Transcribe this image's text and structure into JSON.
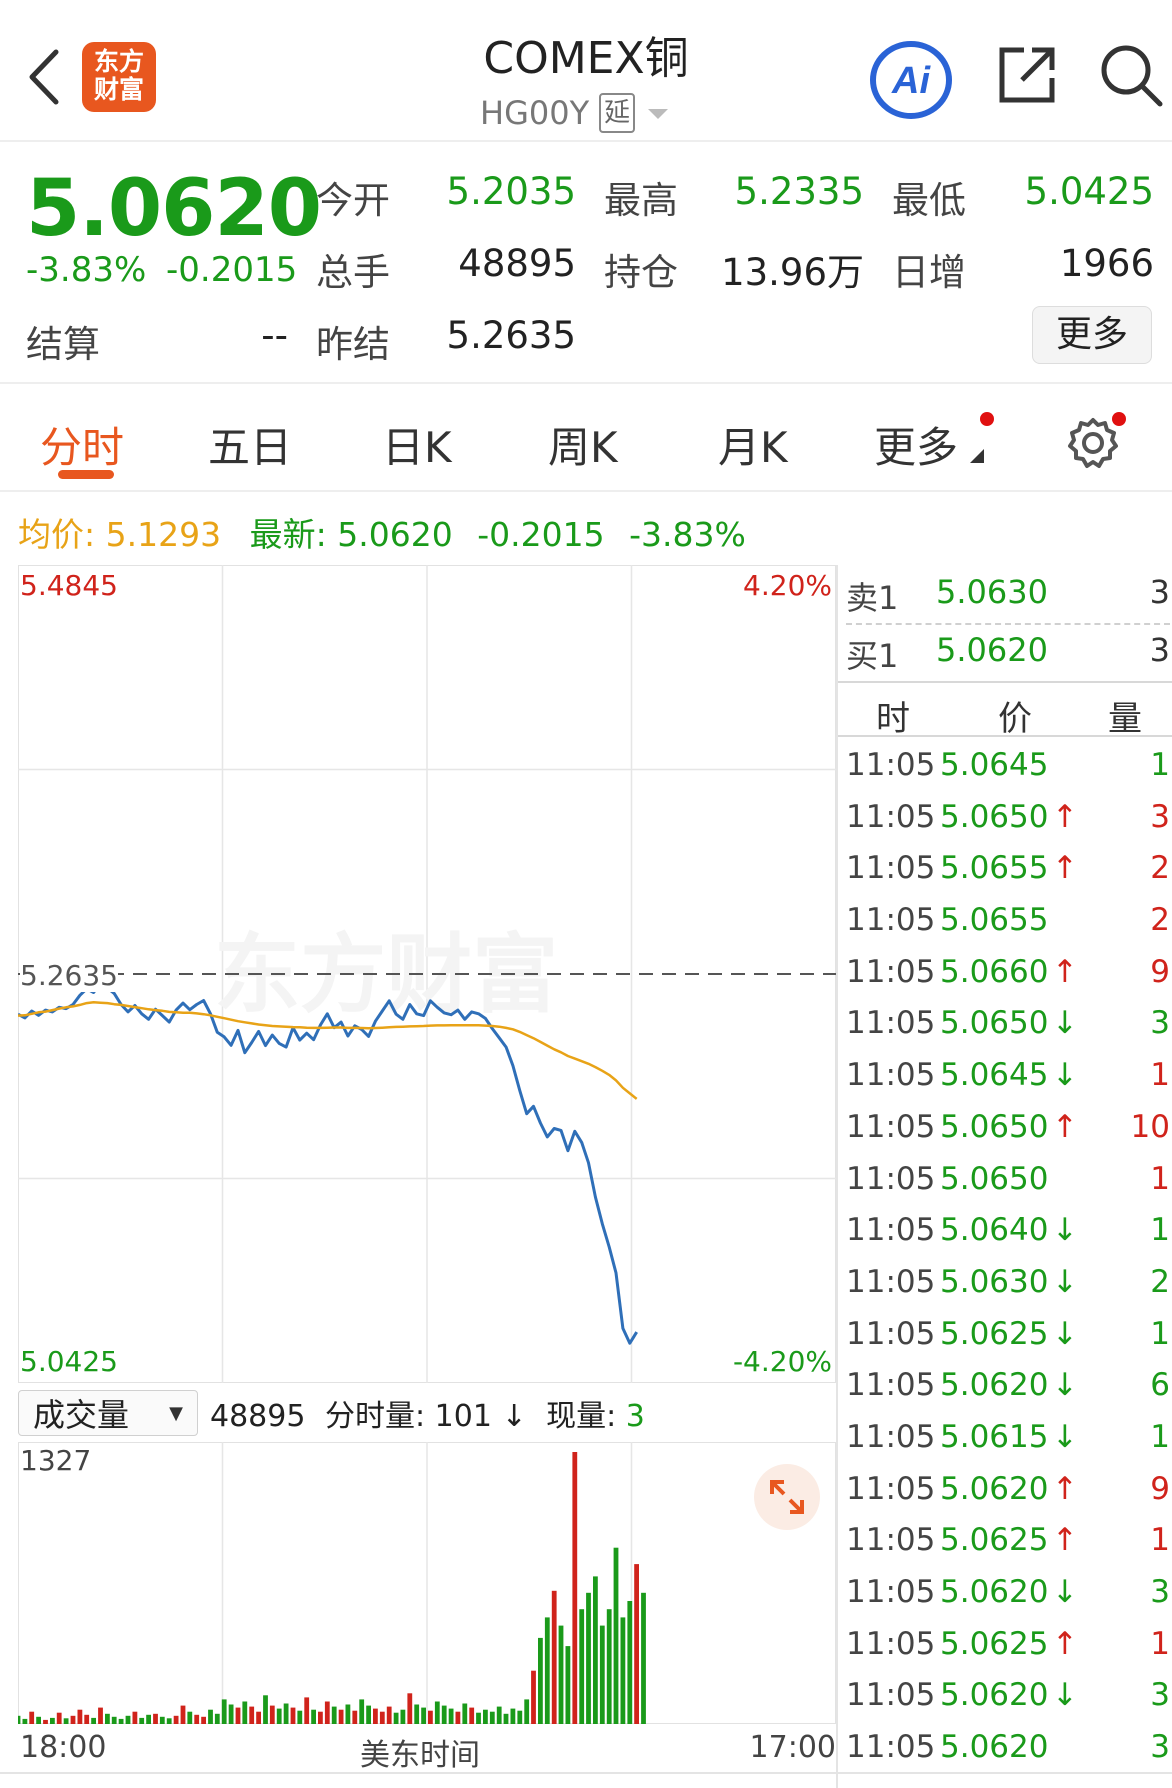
{
  "header": {
    "logo_text": "东方财富",
    "title": "COMEX铜",
    "symbol": "HG00Y",
    "delay_badge": "延",
    "ai_label": "Ai"
  },
  "quote": {
    "last_price": "5.0620",
    "change_pct": "-3.83%",
    "change_abs": "-0.2015",
    "fields": {
      "open_label": "今开",
      "open": "5.2035",
      "high_label": "最高",
      "high": "5.2335",
      "low_label": "最低",
      "low": "5.0425",
      "volume_label": "总手",
      "volume": "48895",
      "oi_label": "持仓",
      "oi": "13.96万",
      "oi_change_label": "日增",
      "oi_change": "1966",
      "settle_label": "结算",
      "settle": "--",
      "prev_settle_label": "昨结",
      "prev_settle": "5.2635"
    },
    "more_button": "更多"
  },
  "tabs": [
    {
      "label": "分时",
      "active": true
    },
    {
      "label": "五日"
    },
    {
      "label": "日K"
    },
    {
      "label": "周K"
    },
    {
      "label": "月K"
    },
    {
      "label": "更多"
    }
  ],
  "info_line": {
    "avg_label": "均价:",
    "avg_value": "5.1293",
    "latest_label": "最新:",
    "latest_value": "5.0620",
    "change_abs": "-0.2015",
    "change_pct": "-3.83%"
  },
  "chart_data": {
    "type": "line",
    "y_max_label": "5.4845",
    "y_min_label": "5.0425",
    "y_max_pct": "4.20%",
    "y_min_pct": "-4.20%",
    "ylim": [
      5.0425,
      5.4845
    ],
    "prev_settle_label": "5.2635",
    "prev_settle": 5.2635,
    "x_start": "18:00",
    "x_mid": "美东时间",
    "x_end": "17:00",
    "session_points": 120,
    "series": [
      {
        "key": "price",
        "color": "#2f6fb8",
        "values": [
          5.2418,
          5.2398,
          5.2435,
          5.2412,
          5.244,
          5.243,
          5.2455,
          5.2448,
          5.247,
          5.252,
          5.2555,
          5.2535,
          5.2585,
          5.256,
          5.253,
          5.247,
          5.243,
          5.2465,
          5.242,
          5.239,
          5.2445,
          5.241,
          5.2375,
          5.244,
          5.2478,
          5.2442,
          5.247,
          5.2492,
          5.242,
          5.232,
          5.2295,
          5.225,
          5.233,
          5.221,
          5.2265,
          5.2325,
          5.2248,
          5.2305,
          5.226,
          5.224,
          5.2345,
          5.2278,
          5.2315,
          5.228,
          5.236,
          5.242,
          5.2345,
          5.2375,
          5.23,
          5.2355,
          5.2335,
          5.2298,
          5.238,
          5.2435,
          5.249,
          5.2418,
          5.239,
          5.247,
          5.242,
          5.241,
          5.249,
          5.2455,
          5.2425,
          5.2415,
          5.244,
          5.239,
          5.243,
          5.242,
          5.2395,
          5.234,
          5.229,
          5.224,
          5.214,
          5.2005,
          5.188,
          5.192,
          5.183,
          5.1755,
          5.18,
          5.179,
          5.168,
          5.1785,
          5.1725,
          5.1615,
          5.143,
          5.1285,
          5.116,
          5.102,
          5.072,
          5.064,
          5.07
        ]
      },
      {
        "key": "average",
        "color": "#e8a317",
        "values": [
          5.241,
          5.2412,
          5.242,
          5.2428,
          5.2432,
          5.244,
          5.2448,
          5.2455,
          5.246,
          5.2468,
          5.2478,
          5.2482,
          5.248,
          5.2478,
          5.2472,
          5.2468,
          5.2462,
          5.2456,
          5.245,
          5.2444,
          5.244,
          5.2436,
          5.243,
          5.2428,
          5.2426,
          5.2426,
          5.2422,
          5.2418,
          5.2412,
          5.2404,
          5.2396,
          5.2388,
          5.238,
          5.2374,
          5.2368,
          5.2362,
          5.2358,
          5.2354,
          5.2352,
          5.235,
          5.2348,
          5.2347,
          5.2345,
          5.2344,
          5.2344,
          5.2345,
          5.2346,
          5.2346,
          5.2344,
          5.2344,
          5.2343,
          5.2342,
          5.2343,
          5.2345,
          5.2347,
          5.2349,
          5.235,
          5.2352,
          5.2353,
          5.2354,
          5.2356,
          5.2357,
          5.2357,
          5.2358,
          5.2358,
          5.2358,
          5.2358,
          5.2358,
          5.2356,
          5.2354,
          5.235,
          5.2344,
          5.2336,
          5.2322,
          5.2305,
          5.2288,
          5.2268,
          5.2248,
          5.2228,
          5.2212,
          5.2192,
          5.2178,
          5.2164,
          5.215,
          5.2132,
          5.2112,
          5.209,
          5.206,
          5.202,
          5.199,
          5.196
        ]
      }
    ]
  },
  "volume": {
    "select_label": "成交量",
    "total": "48895",
    "tick_vol_label": "分时量:",
    "tick_vol": "101",
    "tick_vol_arrow": "↓",
    "current_label": "现量:",
    "current": "3",
    "max_label": "1327",
    "max": 1327,
    "bars": [
      40,
      25,
      60,
      35,
      20,
      30,
      55,
      28,
      40,
      70,
      45,
      30,
      80,
      50,
      35,
      25,
      40,
      60,
      30,
      45,
      50,
      35,
      28,
      40,
      90,
      60,
      45,
      35,
      70,
      50,
      120,
      95,
      80,
      110,
      85,
      60,
      140,
      90,
      75,
      100,
      80,
      65,
      130,
      70,
      60,
      110,
      85,
      70,
      95,
      65,
      120,
      90,
      75,
      60,
      85,
      55,
      70,
      150,
      95,
      80,
      65,
      110,
      90,
      75,
      60,
      100,
      80,
      55,
      70,
      60,
      85,
      50,
      75,
      65,
      120,
      260,
      420,
      520,
      650,
      480,
      380,
      1327,
      560,
      640,
      720,
      480,
      560,
      860,
      520,
      600,
      780,
      640
    ]
  },
  "orderbook": {
    "ask_label": "卖1",
    "ask_price": "5.0630",
    "ask_qty": "3",
    "bid_label": "买1",
    "bid_price": "5.0620",
    "bid_qty": "3"
  },
  "ticks_header": {
    "time": "时",
    "price": "价",
    "qty": "量"
  },
  "ticks": [
    {
      "time": "11:05",
      "price": "5.0645",
      "dir": "",
      "qty": "1",
      "qty_color": "green"
    },
    {
      "time": "11:05",
      "price": "5.0650",
      "dir": "↑",
      "qty": "3",
      "qty_color": "red"
    },
    {
      "time": "11:05",
      "price": "5.0655",
      "dir": "↑",
      "qty": "2",
      "qty_color": "red"
    },
    {
      "time": "11:05",
      "price": "5.0655",
      "dir": "",
      "qty": "2",
      "qty_color": "red"
    },
    {
      "time": "11:05",
      "price": "5.0660",
      "dir": "↑",
      "qty": "9",
      "qty_color": "red"
    },
    {
      "time": "11:05",
      "price": "5.0650",
      "dir": "↓",
      "qty": "3",
      "qty_color": "green"
    },
    {
      "time": "11:05",
      "price": "5.0645",
      "dir": "↓",
      "qty": "1",
      "qty_color": "red"
    },
    {
      "time": "11:05",
      "price": "5.0650",
      "dir": "↑",
      "qty": "10",
      "qty_color": "red"
    },
    {
      "time": "11:05",
      "price": "5.0650",
      "dir": "",
      "qty": "1",
      "qty_color": "red"
    },
    {
      "time": "11:05",
      "price": "5.0640",
      "dir": "↓",
      "qty": "1",
      "qty_color": "green"
    },
    {
      "time": "11:05",
      "price": "5.0630",
      "dir": "↓",
      "qty": "2",
      "qty_color": "green"
    },
    {
      "time": "11:05",
      "price": "5.0625",
      "dir": "↓",
      "qty": "1",
      "qty_color": "green"
    },
    {
      "time": "11:05",
      "price": "5.0620",
      "dir": "↓",
      "qty": "6",
      "qty_color": "green"
    },
    {
      "time": "11:05",
      "price": "5.0615",
      "dir": "↓",
      "qty": "1",
      "qty_color": "green"
    },
    {
      "time": "11:05",
      "price": "5.0620",
      "dir": "↑",
      "qty": "9",
      "qty_color": "red"
    },
    {
      "time": "11:05",
      "price": "5.0625",
      "dir": "↑",
      "qty": "1",
      "qty_color": "red"
    },
    {
      "time": "11:05",
      "price": "5.0620",
      "dir": "↓",
      "qty": "3",
      "qty_color": "green"
    },
    {
      "time": "11:05",
      "price": "5.0625",
      "dir": "↑",
      "qty": "1",
      "qty_color": "red"
    },
    {
      "time": "11:05",
      "price": "5.0620",
      "dir": "↓",
      "qty": "3",
      "qty_color": "green"
    },
    {
      "time": "11:05",
      "price": "5.0620",
      "dir": "",
      "qty": "3",
      "qty_color": "green"
    }
  ],
  "colors": {
    "up": "#d0231b",
    "down": "#1a9a1a",
    "accent": "#e8571f",
    "average": "#e8a317",
    "price_line": "#2f6fb8"
  }
}
